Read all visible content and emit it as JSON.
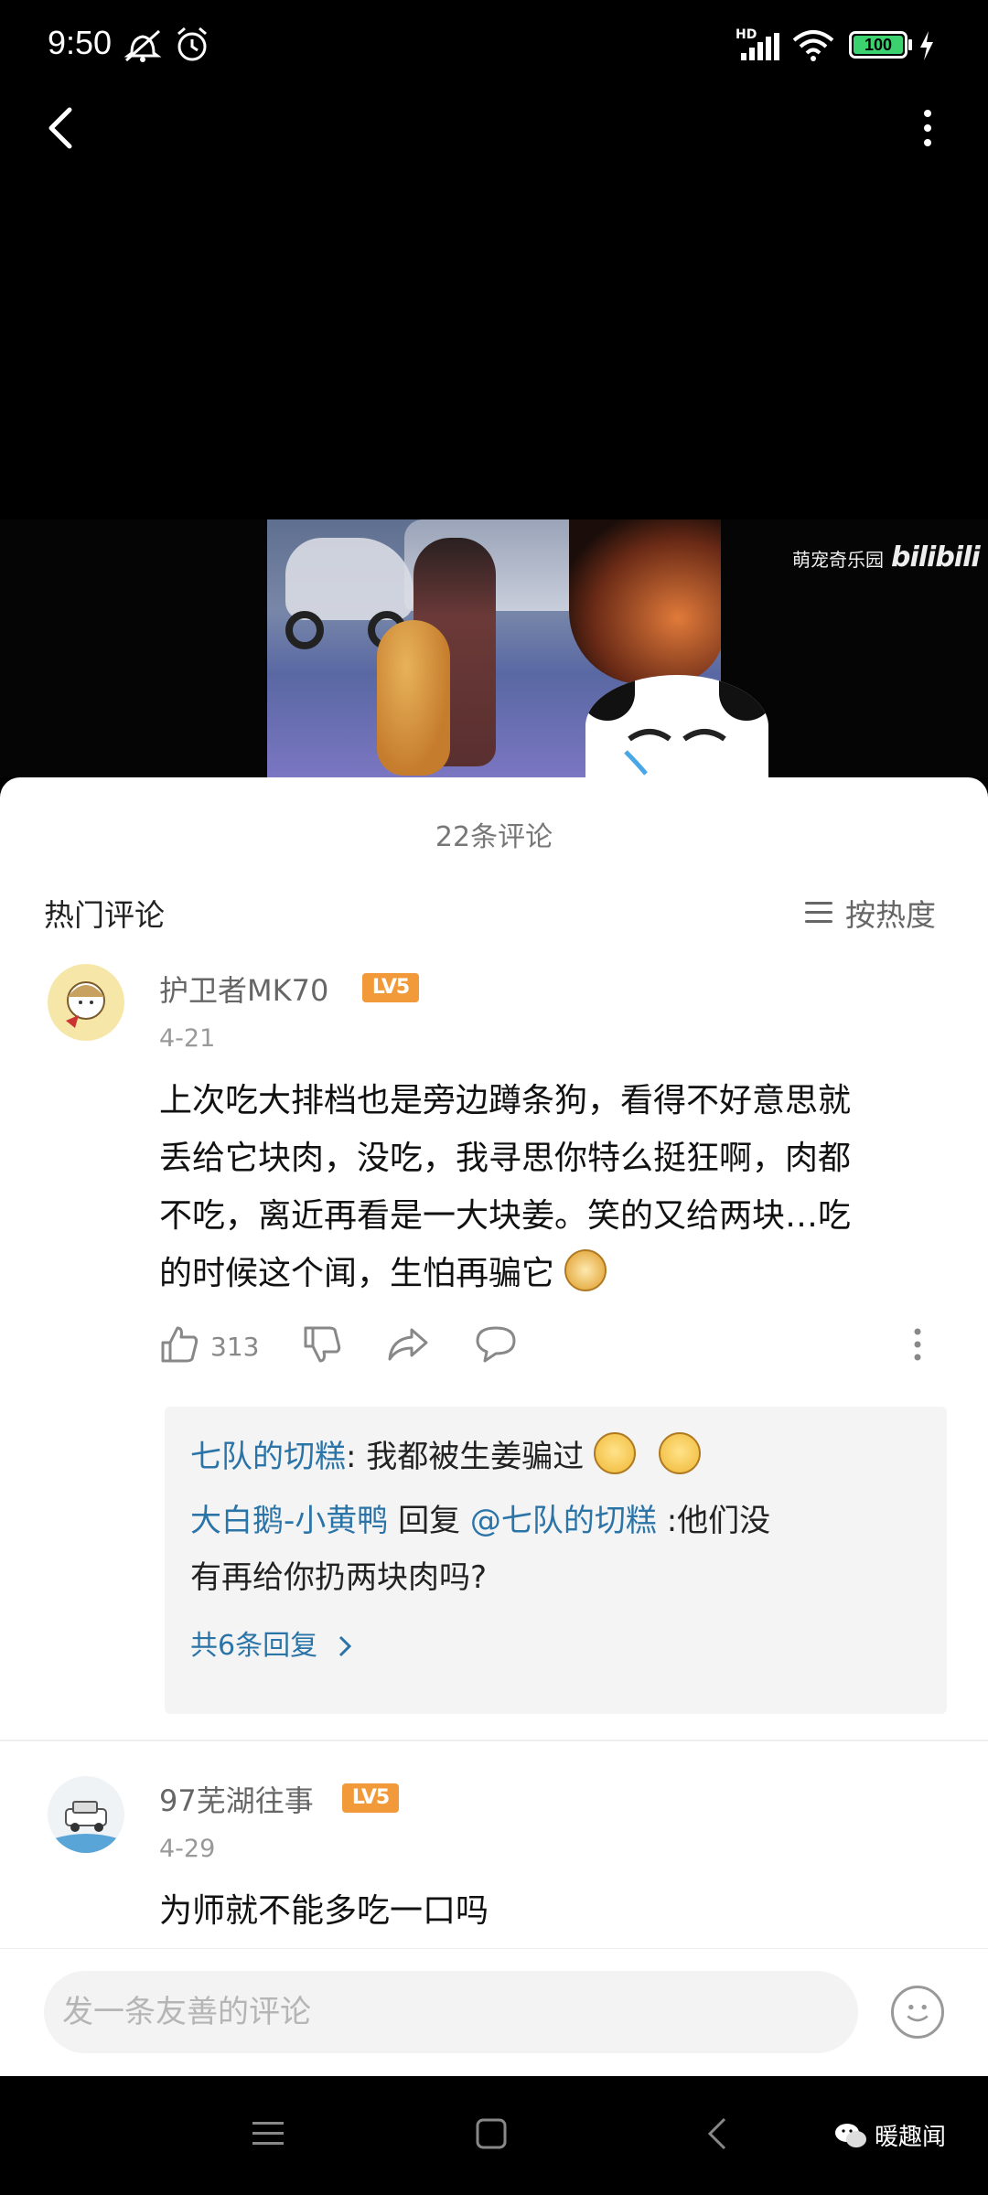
{
  "status_bar": {
    "time": "9:50",
    "battery": "100",
    "network": "HD"
  },
  "video": {
    "watermark_text": "萌宠奇乐园",
    "watermark_brand": "bilibili"
  },
  "comments_header": {
    "count": "22条评论",
    "section_title": "热门评论",
    "sort_label": "按热度"
  },
  "comments": [
    {
      "username": "护卫者MK70",
      "level": "LV5",
      "date": "4-21",
      "text_lines": [
        "上次吃大排档也是旁边蹲条狗，看得不好意思就",
        "丢给它块肉，没吃，我寻思你特么挺狂啊，肉都",
        "不吃，离近再看是一大块姜。笑的又给两块…吃",
        "的时候这个闻，生怕再骗它"
      ],
      "likes": "313",
      "replies": [
        {
          "user": "七队的切糕",
          "text": "我都被生姜骗过"
        },
        {
          "user": "大白鹅-小黄鸭",
          "reply_word": "回复",
          "mention": "@七队的切糕",
          "text_part1": ":他们没",
          "text_part2": "有再给你扔两块肉吗?"
        }
      ],
      "more_replies_label": "共6条回复"
    },
    {
      "username": "97芜湖往事",
      "level": "LV5",
      "date": "4-29",
      "text_lines": [
        "为师就不能多吃一口吗"
      ]
    }
  ],
  "input": {
    "placeholder": "发一条友善的评论"
  },
  "credit": "暖趣闻",
  "colors": {
    "accent_blue": "#2b74a8",
    "level_badge": "#f29a3a",
    "battery_green": "#3bd16f"
  }
}
